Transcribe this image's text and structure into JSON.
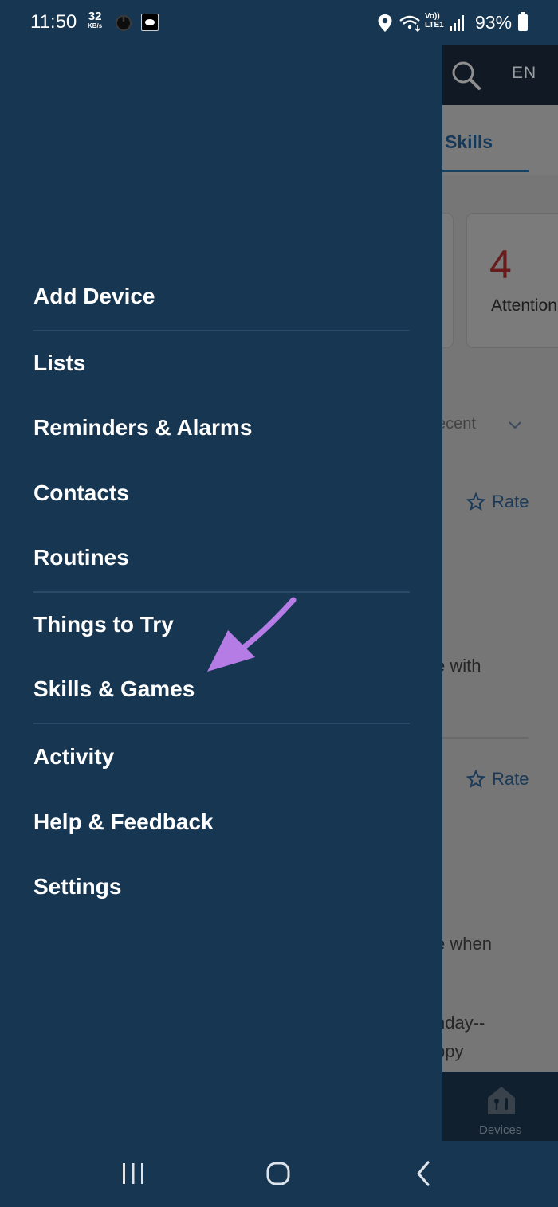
{
  "status_bar": {
    "time": "11:50",
    "net_speed_value": "32",
    "net_speed_unit": "KB/s",
    "lte_line1": "Vo))",
    "lte_line2": "LTE1",
    "battery": "93%"
  },
  "background_app": {
    "language": "EN",
    "active_tab": "Skills",
    "attention_count": "4",
    "attention_label": "Attention",
    "sort_label": "ecent",
    "rate_label": "Rate",
    "snippet_1": "e with",
    "snippet_2": "e when",
    "snippet_3": "hday--",
    "snippet_4": "ppy",
    "bottom_nav_label": "Devices"
  },
  "drawer": {
    "items": [
      {
        "label": "Add Device"
      },
      {
        "label": "Lists"
      },
      {
        "label": "Reminders & Alarms"
      },
      {
        "label": "Contacts"
      },
      {
        "label": "Routines"
      },
      {
        "label": "Things to Try"
      },
      {
        "label": "Skills & Games"
      },
      {
        "label": "Activity"
      },
      {
        "label": "Help & Feedback"
      },
      {
        "label": "Settings"
      }
    ]
  },
  "colors": {
    "drawer_bg": "#173652",
    "arrow": "#b57ce6",
    "attention_number": "#6a1b1b"
  },
  "icons": {
    "power": "power-icon",
    "location": "location-icon",
    "wifi": "wifi-icon",
    "signal": "signal-icon",
    "battery": "battery-icon",
    "search": "search-icon",
    "devices": "devices-icon",
    "annotation": "arrow-annotation-icon"
  }
}
